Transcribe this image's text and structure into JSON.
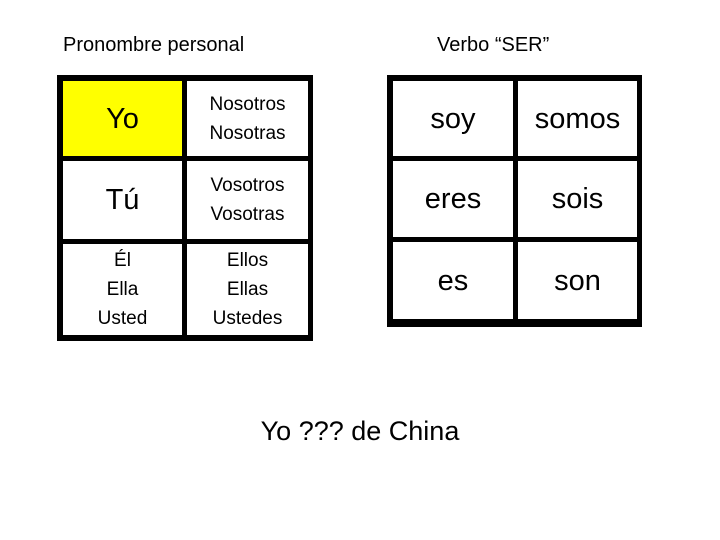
{
  "headings": {
    "pronouns": "Pronombre personal",
    "verb": "Verbo “SER”"
  },
  "pronoun_table": {
    "highlight_color": "#ffff00",
    "rows": [
      {
        "singular": [
          "Yo"
        ],
        "plural": [
          "Nosotros",
          "Nosotras"
        ],
        "highlighted": true
      },
      {
        "singular": [
          "Tú"
        ],
        "plural": [
          "Vosotros",
          "Vosotras"
        ],
        "highlighted": false
      },
      {
        "singular": [
          "Él",
          "Ella",
          "Usted"
        ],
        "plural": [
          "Ellos",
          "Ellas",
          "Ustedes"
        ],
        "highlighted": false
      }
    ]
  },
  "verb_table": {
    "rows": [
      {
        "singular": "soy",
        "plural": "somos"
      },
      {
        "singular": "eres",
        "plural": "sois"
      },
      {
        "singular": "es",
        "plural": "son"
      }
    ]
  },
  "prompt_sentence": "Yo ??? de China"
}
